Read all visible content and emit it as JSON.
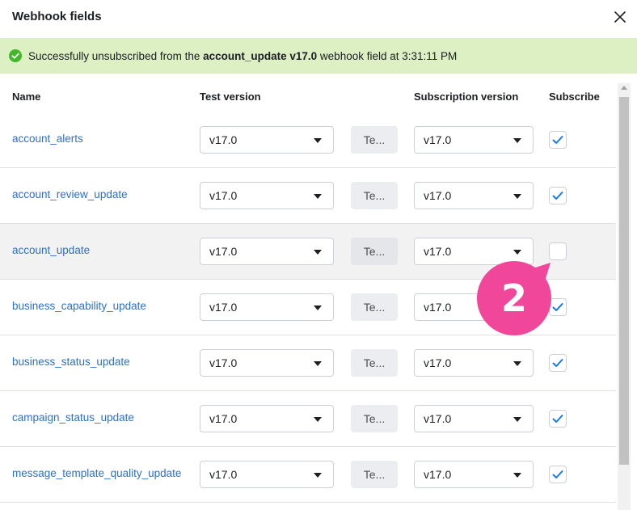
{
  "dialog": {
    "title": "Webhook fields"
  },
  "banner": {
    "prefix": "Successfully unsubscribed from the ",
    "field": "account_update v17.0",
    "suffix": " webhook field at 3:31:11 PM",
    "color": "#dcf0c4",
    "icon": "check-circle-icon"
  },
  "table": {
    "headers": {
      "name": "Name",
      "test_version": "Test version",
      "subscription_version": "Subscription version",
      "subscribe": "Subscribe"
    },
    "test_button_label": "Te...",
    "rows": [
      {
        "name": "account_alerts",
        "test_version": "v17.0",
        "subscription_version": "v17.0",
        "subscribed": true
      },
      {
        "name": "account_review_update",
        "test_version": "v17.0",
        "subscription_version": "v17.0",
        "subscribed": true
      },
      {
        "name": "account_update",
        "test_version": "v17.0",
        "subscription_version": "v17.0",
        "subscribed": false
      },
      {
        "name": "business_capability_update",
        "test_version": "v17.0",
        "subscription_version": "v17.0",
        "subscribed": true
      },
      {
        "name": "business_status_update",
        "test_version": "v17.0",
        "subscription_version": "v17.0",
        "subscribed": true
      },
      {
        "name": "campaign_status_update",
        "test_version": "v17.0",
        "subscription_version": "v17.0",
        "subscribed": true
      },
      {
        "name": "message_template_quality_update",
        "test_version": "v17.0",
        "subscription_version": "v17.0",
        "subscribed": true
      }
    ]
  },
  "annotation": {
    "step": "2",
    "color": "#f0479b"
  },
  "colors": {
    "link": "#2d6fd0",
    "check": "#1877f2"
  }
}
